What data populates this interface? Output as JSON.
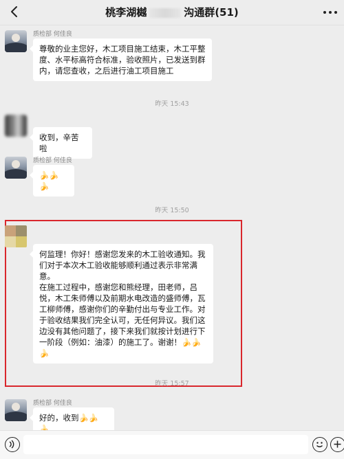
{
  "header": {
    "title_left": "桃李湖樾",
    "title_right": "沟通群(51)"
  },
  "messages": {
    "m1": {
      "sender": "质检部 何佳良",
      "lines": [
        "尊敬的业主您好，木工项目施工结束，木工平整",
        "度、水平标高符合标准，验收照片，已发送到群",
        "内，请您查收，之后进行油工项目施工"
      ]
    },
    "time1": "昨天 15:43",
    "m2": {
      "text": "收到，辛苦啦"
    },
    "m3": {
      "sender": "质检部 何佳良",
      "text": "🍌🍌🍌"
    },
    "time2": "昨天 15:50",
    "m4": {
      "lines": [
        "何监理！你好！感谢您发来的木工验收通知。我",
        "们对于本次木工验收能够顺利通过表示非常满",
        "意。",
        "在施工过程中，感谢您和熊经理，田老师，吕",
        "悦，木工朱师傅以及前期水电改造的盛师傅，瓦",
        "工柳师傅，感谢你们的辛勤付出与专业工作。对",
        "于验收结果我们完全认可，无任何异议。我们这",
        "边没有其他问题了，接下来我们就按计划进行下",
        "一阶段（例如：油漆）的施工了。谢谢！🍌🍌",
        "🍌"
      ]
    },
    "time3": "昨天 15:57",
    "m5": {
      "sender": "质检部 何佳良",
      "text": "好的，收到🍌🍌🍌"
    }
  },
  "colors": {
    "background": "#ededed",
    "bubble": "#ffffff",
    "highlight_border": "#d9262c"
  }
}
